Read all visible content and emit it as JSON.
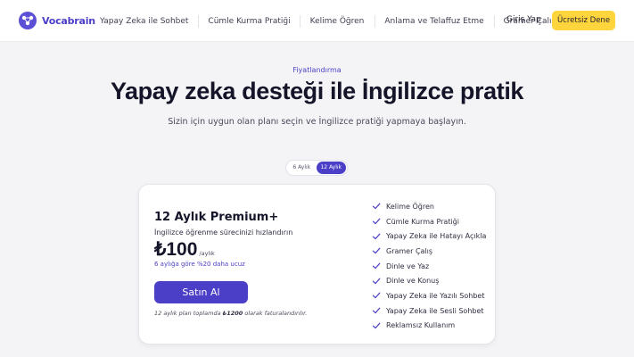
{
  "brand": {
    "name": "Vocabrain",
    "accent": "#4b3fc7",
    "cta_color": "#ffd53d"
  },
  "nav": {
    "links": [
      "Yapay Zeka ile Sohbet",
      "Cümle Kurma Pratiği",
      "Kelime Öğren",
      "Anlama ve Telaffuz Etme",
      "Gramer Çalış"
    ],
    "login": "Giriş Yap",
    "cta": "Ücretsiz Dene"
  },
  "hero": {
    "eyebrow": "Fiyatlandırma",
    "title": "Yapay zeka desteği ile İngilizce pratik",
    "subtitle": "Sizin için uygun olan planı seçin ve İngilizce pratiği yapmaya başlayın."
  },
  "toggle": {
    "options": [
      "6 Aylık",
      "12 Aylık"
    ],
    "selected": "12 Aylık"
  },
  "plan": {
    "title": "12 Aylık Premium+",
    "description": "İngilizce öğrenme sürecinizi hızlandırın",
    "price": "₺100",
    "price_unit": "/aylık",
    "discount": "6 aylığa göre %20 daha ucuz",
    "buy_label": "Satın Al",
    "billing_pre": "12 aylık plan toplamda ",
    "billing_amount": "₺1200",
    "billing_post": " olarak faturalandırılır.",
    "features": [
      "Kelime Öğren",
      "Cümle Kurma Pratiği",
      "Yapay Zeka ile Hatayı Açıkla",
      "Gramer Çalış",
      "Dinle ve Yaz",
      "Dinle ve Konuş",
      "Yapay Zeka ile Yazılı Sohbet",
      "Yapay Zeka ile Sesli Sohbet",
      "Reklamsız Kullanım"
    ],
    "feature_icon": "check-icon"
  }
}
